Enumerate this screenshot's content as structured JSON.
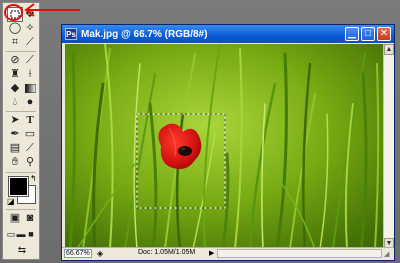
{
  "document": {
    "title": "Mak.jpg @ 66.7% (RGB/8#)",
    "app_icon": "Ps",
    "zoom": "66.67%",
    "doc_info": "Doc: 1.05M/1.05M"
  },
  "icons": {
    "minimize": "minimize-icon",
    "maximize": "maximize-icon",
    "close": "close-icon"
  },
  "colors": {
    "foreground": "#000000",
    "background": "#ffffff",
    "annotation": "#e01010",
    "titlebar": "#0a5bd6"
  }
}
